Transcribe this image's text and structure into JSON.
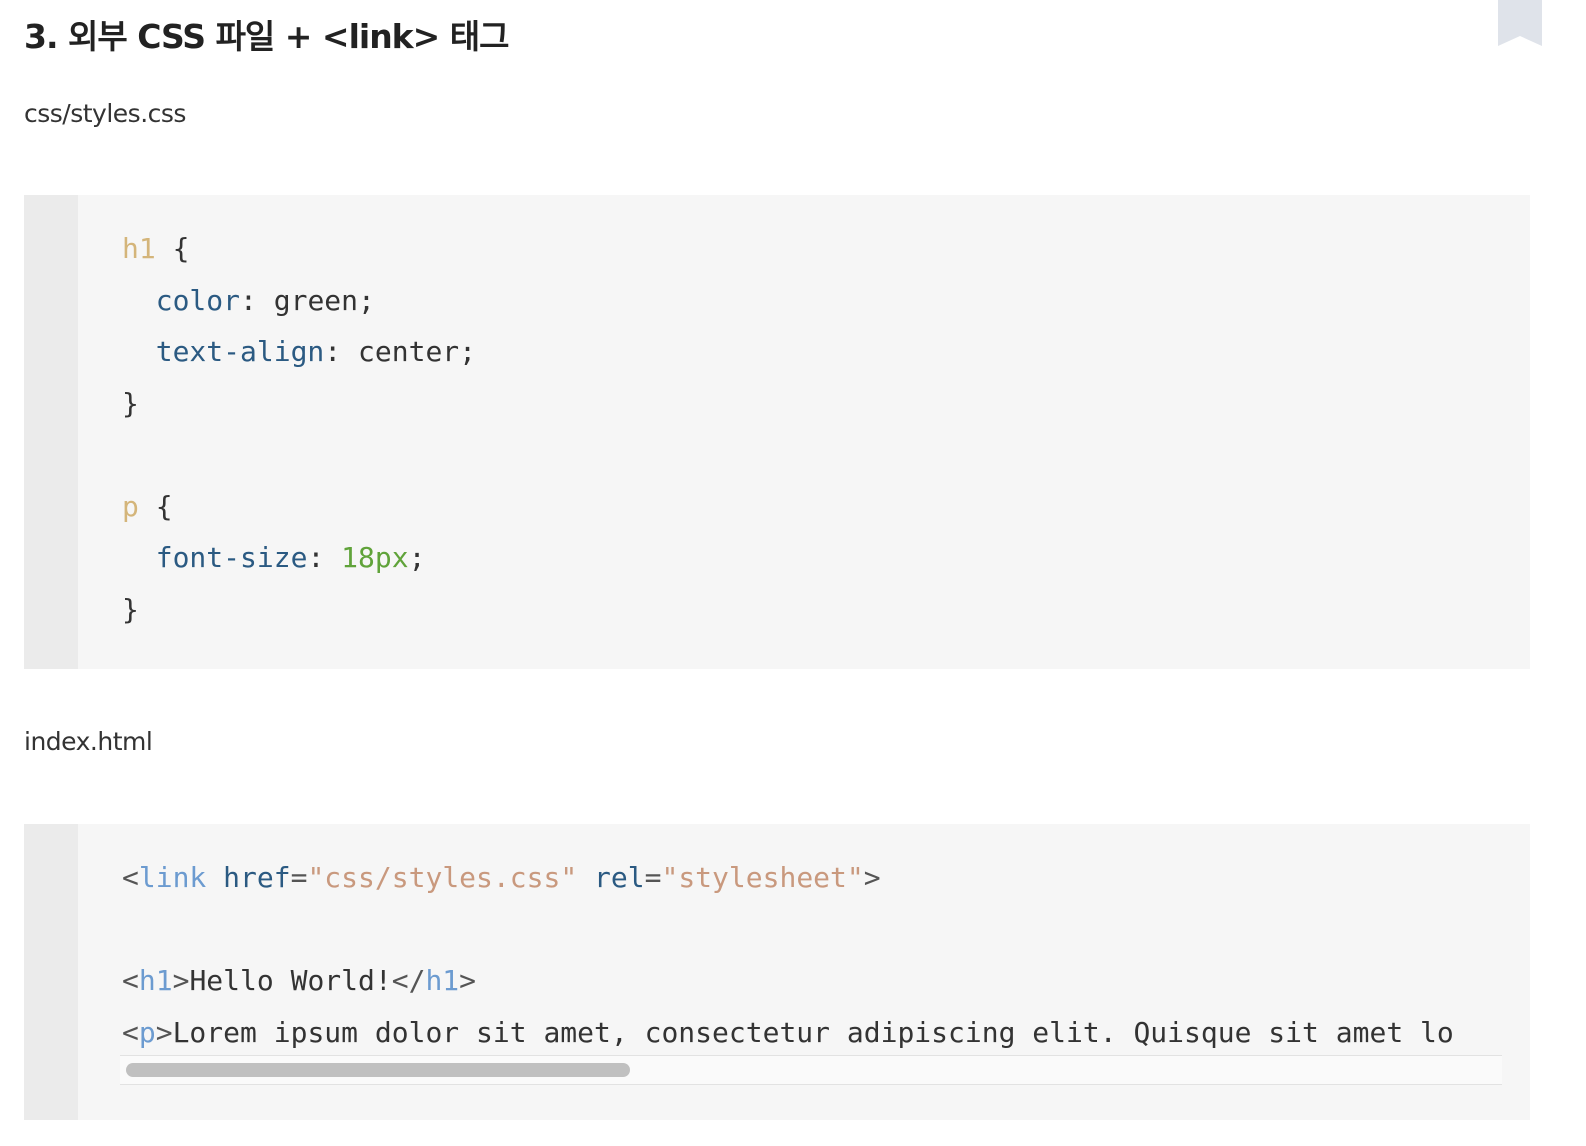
{
  "heading": "3. 외부 CSS 파일 + <link> 태그",
  "css_file": {
    "label": "css/styles.css",
    "lines": [
      [
        {
          "t": "h1",
          "c": "sel"
        },
        {
          "t": " {",
          "c": "plain"
        }
      ],
      [
        {
          "t": "  ",
          "c": "plain"
        },
        {
          "t": "color",
          "c": "prop"
        },
        {
          "t": ": green;",
          "c": "plain"
        }
      ],
      [
        {
          "t": "  ",
          "c": "plain"
        },
        {
          "t": "text-align",
          "c": "prop"
        },
        {
          "t": ": center;",
          "c": "plain"
        }
      ],
      [
        {
          "t": "}",
          "c": "plain"
        }
      ],
      [],
      [
        {
          "t": "p",
          "c": "sel"
        },
        {
          "t": " {",
          "c": "plain"
        }
      ],
      [
        {
          "t": "  ",
          "c": "plain"
        },
        {
          "t": "font-size",
          "c": "prop"
        },
        {
          "t": ": ",
          "c": "plain"
        },
        {
          "t": "18px",
          "c": "num"
        },
        {
          "t": ";",
          "c": "plain"
        }
      ],
      [
        {
          "t": "}",
          "c": "plain"
        }
      ]
    ]
  },
  "html_file": {
    "label": "index.html",
    "lines": [
      [
        {
          "t": "<",
          "c": "punct"
        },
        {
          "t": "link",
          "c": "tag"
        },
        {
          "t": " ",
          "c": "plain"
        },
        {
          "t": "href",
          "c": "attr"
        },
        {
          "t": "=",
          "c": "punct"
        },
        {
          "t": "\"css/styles.css\"",
          "c": "str"
        },
        {
          "t": " ",
          "c": "plain"
        },
        {
          "t": "rel",
          "c": "attr"
        },
        {
          "t": "=",
          "c": "punct"
        },
        {
          "t": "\"stylesheet\"",
          "c": "str"
        },
        {
          "t": ">",
          "c": "punct"
        }
      ],
      [],
      [
        {
          "t": "<",
          "c": "punct"
        },
        {
          "t": "h1",
          "c": "tag"
        },
        {
          "t": ">",
          "c": "punct"
        },
        {
          "t": "Hello World!",
          "c": "plain"
        },
        {
          "t": "</",
          "c": "punct"
        },
        {
          "t": "h1",
          "c": "tag"
        },
        {
          "t": ">",
          "c": "punct"
        }
      ],
      [
        {
          "t": "<",
          "c": "punct"
        },
        {
          "t": "p",
          "c": "tag"
        },
        {
          "t": ">",
          "c": "punct"
        },
        {
          "t": "Lorem ipsum dolor sit amet, consectetur adipiscing elit. Quisque sit amet lo",
          "c": "plain"
        }
      ]
    ]
  },
  "colors": {
    "selector": "#d4b57a",
    "property": "#2b5a82",
    "number": "#60a33a",
    "tag": "#6c9bd0",
    "string": "#c9997e",
    "code_background": "#f6f6f6",
    "gutter_background": "#ebebeb"
  },
  "icons": {
    "bookmark": "bookmark-icon"
  }
}
